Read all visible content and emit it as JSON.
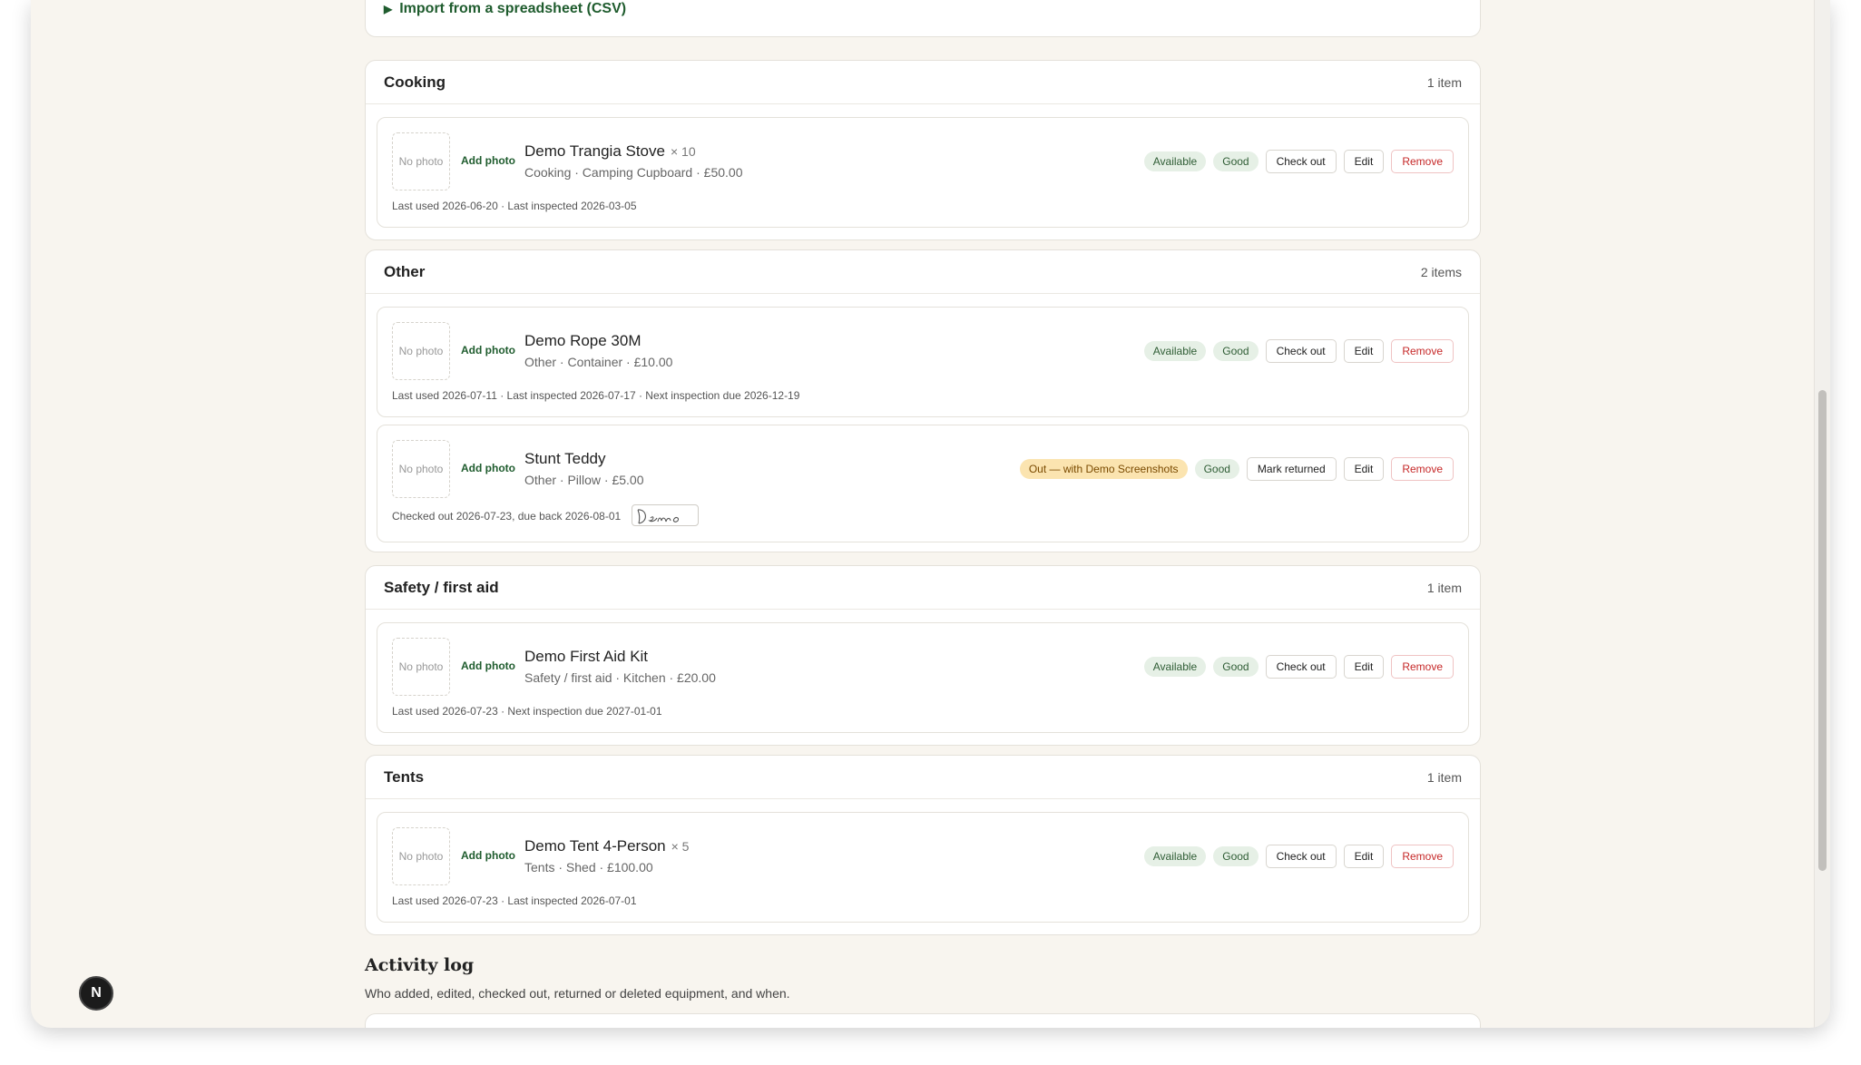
{
  "import": {
    "label": "Import from a spreadsheet (CSV)"
  },
  "common": {
    "no_photo": "No photo",
    "add_photo": "Add photo",
    "edit": "Edit",
    "remove": "Remove",
    "check_out": "Check out",
    "mark_returned": "Mark returned"
  },
  "sections": [
    {
      "title": "Cooking",
      "count": "1 item",
      "items": [
        {
          "name": "Demo Trangia Stove",
          "qty": "× 10",
          "meta": "Cooking · Camping Cupboard · £50.00",
          "status": "Available",
          "condition": "Good",
          "foot": "Last used 2026-06-20 · Last inspected 2026-03-05"
        }
      ]
    },
    {
      "title": "Other",
      "count": "2 items",
      "items": [
        {
          "name": "Demo Rope 30M",
          "qty": "",
          "meta": "Other · Container · £10.00",
          "status": "Available",
          "condition": "Good",
          "foot": "Last used 2026-07-11 · Last inspected 2026-07-17 · Next inspection due 2026-12-19"
        },
        {
          "name": "Stunt Teddy",
          "qty": "",
          "meta": "Other · Pillow · £5.00",
          "status": "Out — with Demo Screenshots",
          "condition": "Good",
          "foot": "Checked out 2026-07-23, due back 2026-08-01",
          "signature": "Demo"
        }
      ]
    },
    {
      "title": "Safety / first aid",
      "count": "1 item",
      "items": [
        {
          "name": "Demo First Aid Kit",
          "qty": "",
          "meta": "Safety / first aid · Kitchen · £20.00",
          "status": "Available",
          "condition": "Good",
          "foot": "Last used 2026-07-23 · Next inspection due 2027-01-01"
        }
      ]
    },
    {
      "title": "Tents",
      "count": "1 item",
      "items": [
        {
          "name": "Demo Tent 4-Person",
          "qty": "× 5",
          "meta": "Tents · Shed · £100.00",
          "status": "Available",
          "condition": "Good",
          "foot": "Last used 2026-07-23 · Last inspected 2026-07-01"
        }
      ]
    }
  ],
  "activity": {
    "title": "Activity log",
    "subtitle": "Who added, edited, checked out, returned or deleted equipment, and when."
  },
  "dev_badge": {
    "label": "N"
  },
  "colors": {
    "accent": "#1f5c2e",
    "danger": "#c62828",
    "out_badge": "#fbe4b0",
    "page_bg": "#f8f5ef"
  }
}
